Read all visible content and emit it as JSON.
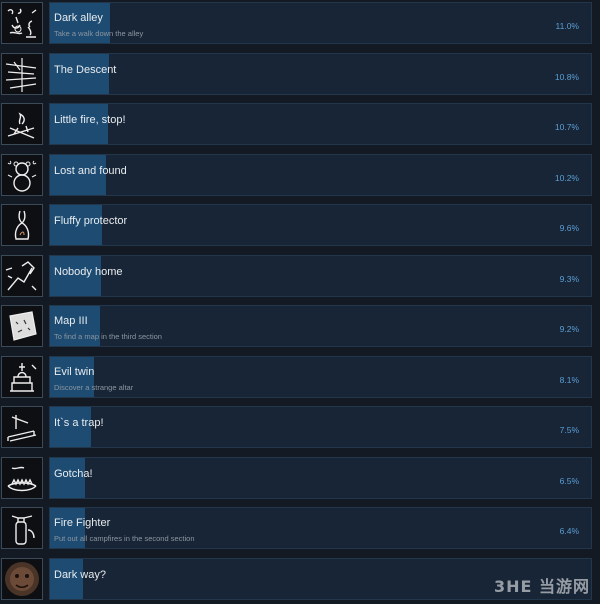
{
  "achievements": [
    {
      "name": "Dark alley",
      "description": "Take a walk down the alley",
      "percent": "11.0%",
      "icon": "chase-icon",
      "fill": 11.0
    },
    {
      "name": "The Descent",
      "description": "",
      "percent": "10.8%",
      "icon": "descent-icon",
      "fill": 10.8
    },
    {
      "name": "Little fire, stop!",
      "description": "",
      "percent": "10.7%",
      "icon": "campfire-icon",
      "fill": 10.7
    },
    {
      "name": "Lost and found",
      "description": "",
      "percent": "10.2%",
      "icon": "teddy-bear-icon",
      "fill": 10.2
    },
    {
      "name": "Fluffy protector",
      "description": "",
      "percent": "9.6%",
      "icon": "rabbit-icon",
      "fill": 9.6
    },
    {
      "name": "Nobody home",
      "description": "",
      "percent": "9.3%",
      "icon": "door-knock-icon",
      "fill": 9.3
    },
    {
      "name": "Map III",
      "description": "To find a map in the third section",
      "percent": "9.2%",
      "icon": "map-icon",
      "fill": 9.2
    },
    {
      "name": "Evil twin",
      "description": "Discover a strange altar",
      "percent": "8.1%",
      "icon": "altar-icon",
      "fill": 8.1
    },
    {
      "name": "It`s a trap!",
      "description": "",
      "percent": "7.5%",
      "icon": "trap-icon",
      "fill": 7.5
    },
    {
      "name": "Gotcha!",
      "description": "",
      "percent": "6.5%",
      "icon": "bear-trap-icon",
      "fill": 6.5
    },
    {
      "name": "Fire Fighter",
      "description": "Put out all campfires in the second section",
      "percent": "6.4%",
      "icon": "fire-extinguisher-icon",
      "fill": 6.4
    },
    {
      "name": "Dark way?",
      "description": "",
      "percent": "",
      "icon": "dark-face-icon",
      "fill": 6.0
    }
  ],
  "watermark": "3HE 当游网"
}
